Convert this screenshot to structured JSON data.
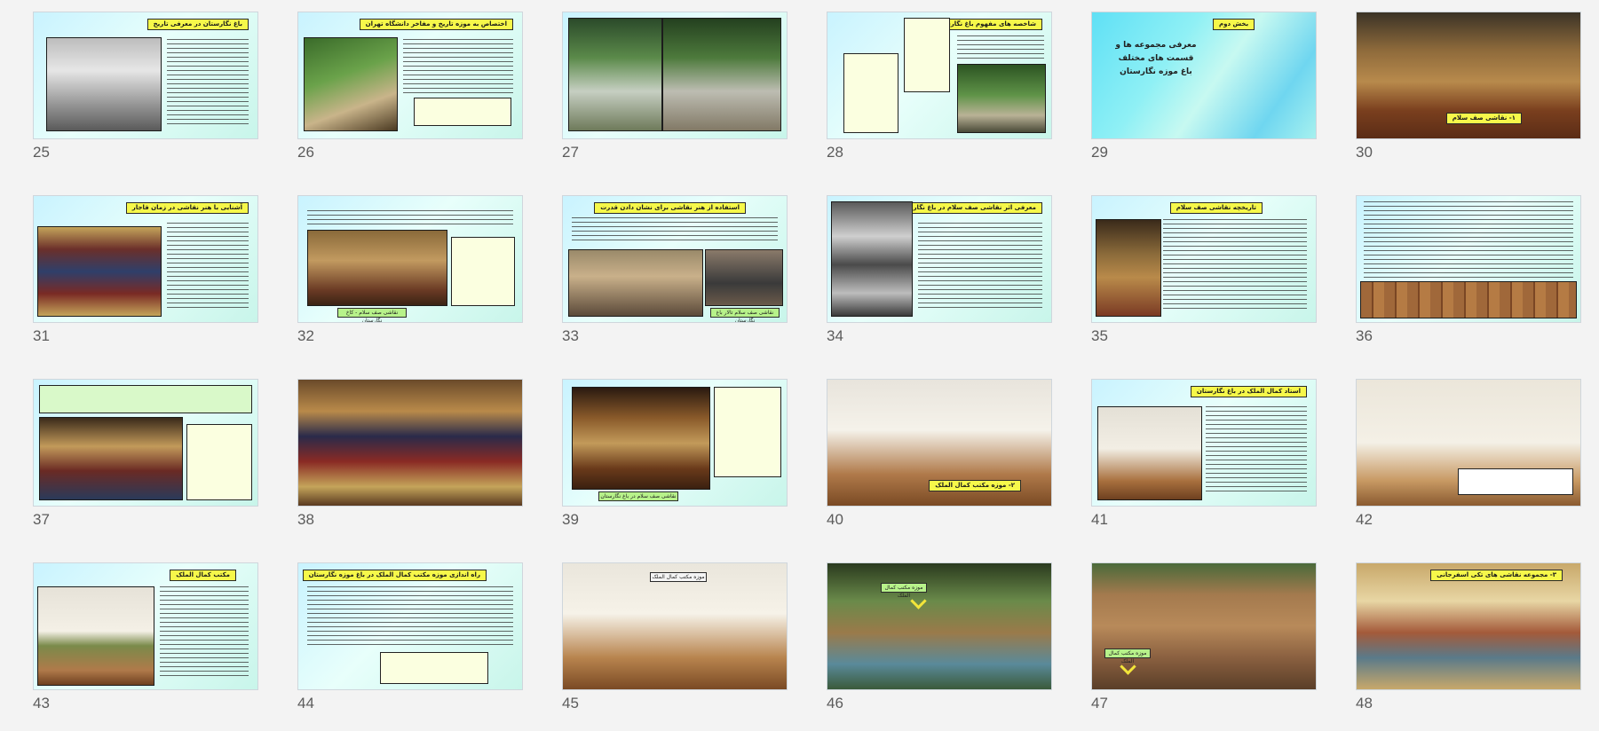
{
  "slides": [
    {
      "num": "25",
      "title": "باغ نگارستان در معرفی تاریخ"
    },
    {
      "num": "26",
      "title": "اختصاص به موزه تاریخ و مفاخر دانشگاه تهران"
    },
    {
      "num": "27",
      "title": ""
    },
    {
      "num": "28",
      "title": "شاخصه های مفهوم باغ نگارستان"
    },
    {
      "num": "29",
      "title": "بخش دوم",
      "heading": "معرفی مجموعه ها و قسمت های مختلف باغ موزه نگارستان"
    },
    {
      "num": "30",
      "title": "",
      "badge": "۱- نقاشی صف سلام"
    },
    {
      "num": "31",
      "title": "آشنایی با هنر نقاشی در زمان قاجار"
    },
    {
      "num": "32",
      "title": "",
      "caption": "نقاشی صف سلام - کاخ نگارستان"
    },
    {
      "num": "33",
      "title": "استفاده از هنر نقاشی برای نشان دادن قدرت",
      "caption": "نقاشی صف سلام تالار باغ نگارستان"
    },
    {
      "num": "34",
      "title": "معرفی اثر نقاشی صف سلام در باغ نگارستان"
    },
    {
      "num": "35",
      "title": "تاریخچه نقاشی صف سلام"
    },
    {
      "num": "36",
      "title": ""
    },
    {
      "num": "37",
      "title": ""
    },
    {
      "num": "38",
      "title": ""
    },
    {
      "num": "39",
      "title": "",
      "caption": "نقاشی صف سلام در باغ نگارستان"
    },
    {
      "num": "40",
      "title": "",
      "badge": "۲- موزه مکتب کمال الملک"
    },
    {
      "num": "41",
      "title": "استاد کمال الملک در باغ نگارستان"
    },
    {
      "num": "42",
      "title": ""
    },
    {
      "num": "43",
      "title": "مکتب کمال الملک"
    },
    {
      "num": "44",
      "title": "راه اندازی موزه مکتب کمال الملک در باغ موزه نگارستان"
    },
    {
      "num": "45",
      "title": "",
      "label": "موزه مکتب کمال الملک"
    },
    {
      "num": "46",
      "title": "",
      "label": "موزه مکتب کمال الملک"
    },
    {
      "num": "47",
      "title": "",
      "label": "موزه مکتب کمال الملک"
    },
    {
      "num": "48",
      "title": "۳- مجموعه نقاشی های تکی اسفرجانی"
    }
  ],
  "colors": {
    "title_bg": "#f6f84a",
    "caption_bg": "#b7f28a",
    "slide_bg": "#d8f7fb"
  }
}
